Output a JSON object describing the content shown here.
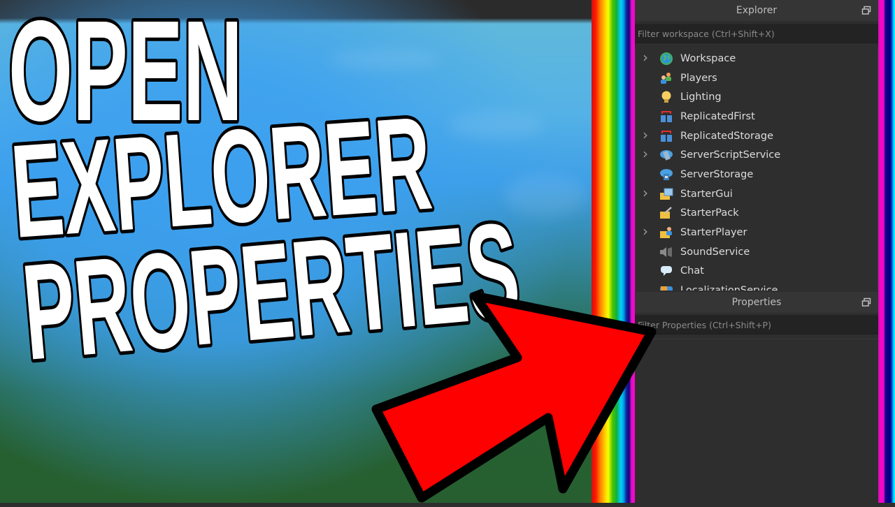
{
  "headline": {
    "line1": "OPEN",
    "line2": "EXPLORER",
    "line3": "PROPERTIES",
    "fill_color": "#ffffff",
    "outline_color": "#000000"
  },
  "arrow": {
    "fill_color": "#ff0000",
    "outline_color": "#000000",
    "direction": "up-right"
  },
  "explorer": {
    "title": "Explorer",
    "undock_icon": "undock-icon",
    "filter_placeholder": "Filter workspace (Ctrl+Shift+X)",
    "items": [
      {
        "label": "Workspace",
        "icon": "workspace-globe-icon",
        "expandable": true
      },
      {
        "label": "Players",
        "icon": "players-icon",
        "expandable": false
      },
      {
        "label": "Lighting",
        "icon": "lighting-bulb-icon",
        "expandable": false
      },
      {
        "label": "ReplicatedFirst",
        "icon": "replicated-first-icon",
        "expandable": false
      },
      {
        "label": "ReplicatedStorage",
        "icon": "replicated-storage-icon",
        "expandable": true
      },
      {
        "label": "ServerScriptService",
        "icon": "server-script-service-icon",
        "expandable": true
      },
      {
        "label": "ServerStorage",
        "icon": "server-storage-icon",
        "expandable": false
      },
      {
        "label": "StarterGui",
        "icon": "starter-gui-icon",
        "expandable": true
      },
      {
        "label": "StarterPack",
        "icon": "starter-pack-icon",
        "expandable": false
      },
      {
        "label": "StarterPlayer",
        "icon": "starter-player-icon",
        "expandable": true
      },
      {
        "label": "SoundService",
        "icon": "sound-service-icon",
        "expandable": false
      },
      {
        "label": "Chat",
        "icon": "chat-bubble-icon",
        "expandable": false
      },
      {
        "label": "LocalizationService",
        "icon": "localization-service-icon",
        "expandable": false
      }
    ]
  },
  "properties": {
    "title": "Properties",
    "undock_icon": "undock-icon",
    "filter_placeholder": "Filter Properties (Ctrl+Shift+P)"
  },
  "colors": {
    "panel_bg": "#2e2e2e",
    "panel_header_bg": "#353535",
    "filter_bg": "#232323",
    "text": "#dcdcdc",
    "placeholder": "#8a8a8a"
  }
}
